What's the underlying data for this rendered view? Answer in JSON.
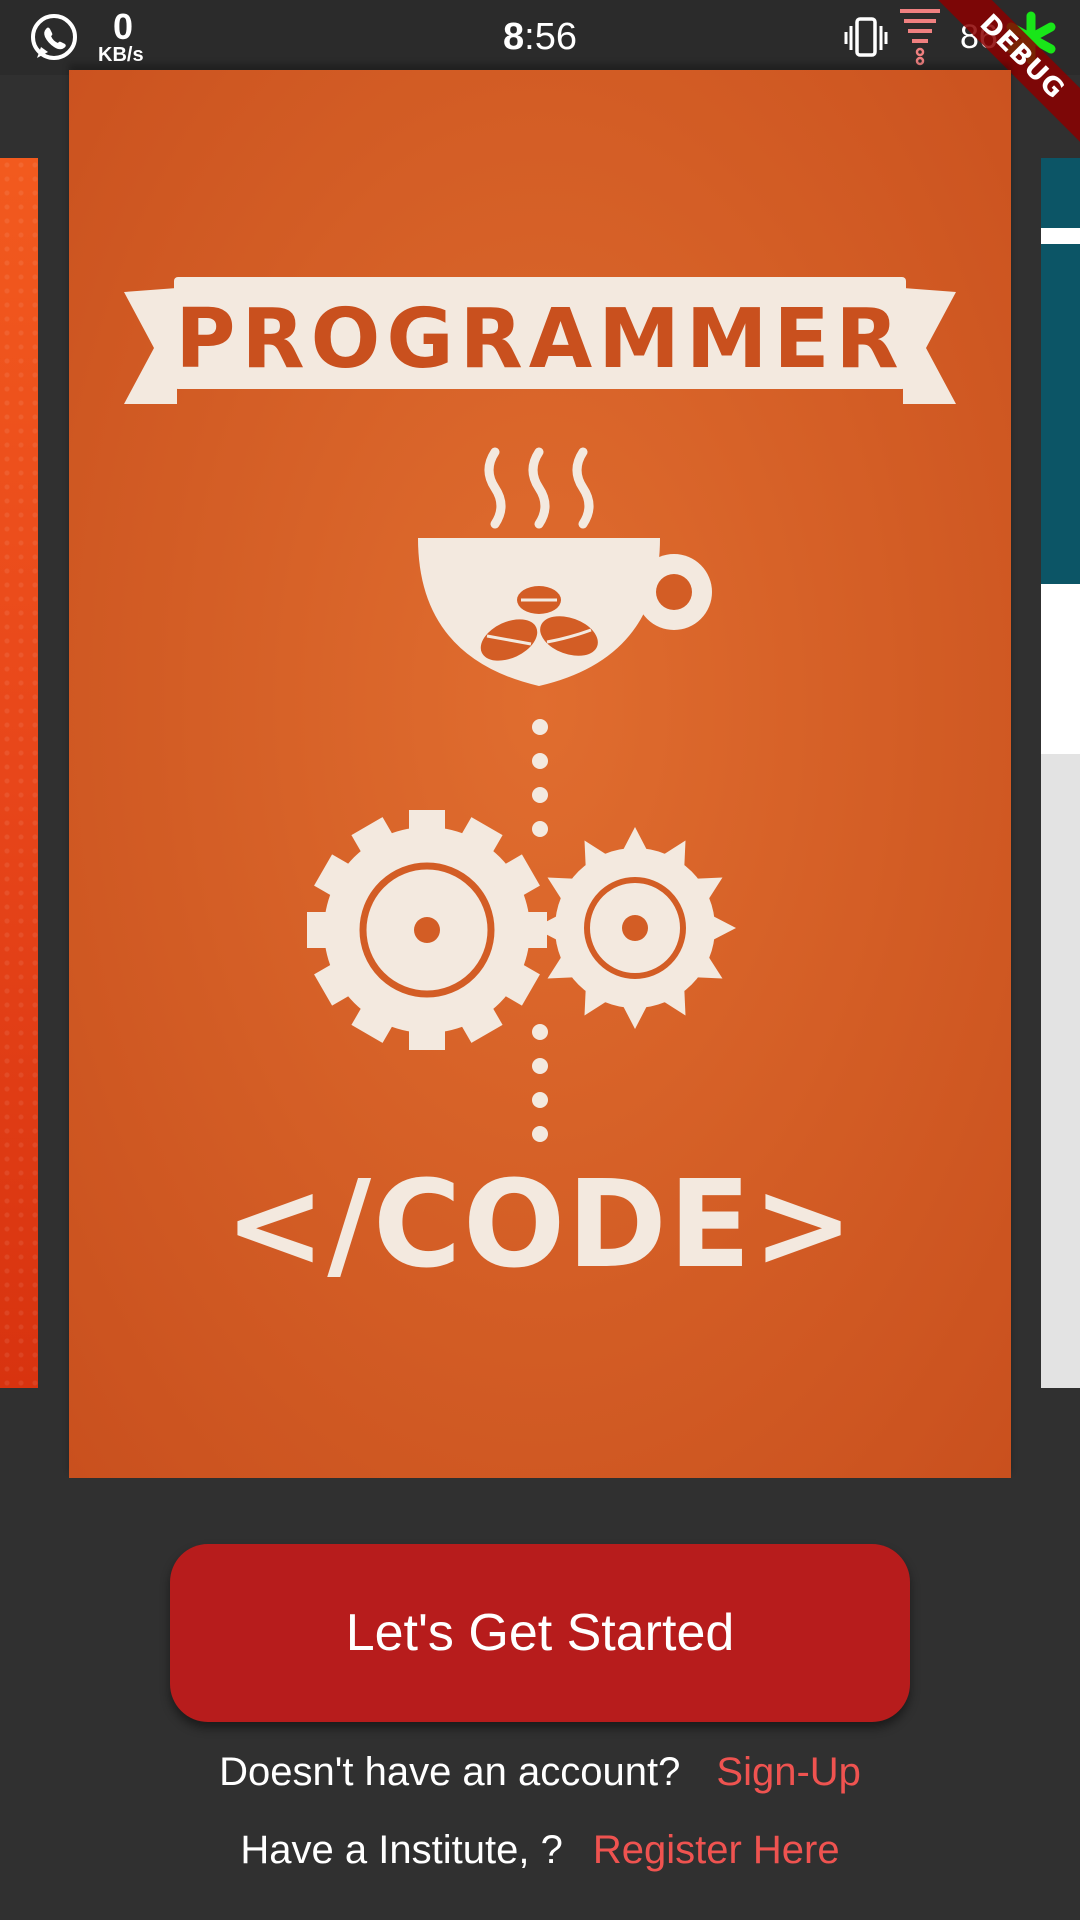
{
  "status_bar": {
    "net_speed_value": "0",
    "net_speed_unit": "KB/s",
    "time_hour": "8",
    "time_rest": ":56",
    "battery": "86",
    "icons": [
      "whatsapp-icon",
      "vibrate-icon",
      "signal-icon",
      "app-icon"
    ]
  },
  "debug_banner": "DEBUG",
  "carousel": {
    "poster_title": "PROGRAMMER",
    "poster_footer": "</CODE>",
    "colors": {
      "poster_bg": "#d35d25",
      "poster_ink": "#f3e9df"
    }
  },
  "actions": {
    "get_started": "Let's Get Started",
    "signup_question": "Doesn't have an account?",
    "signup_link": "Sign-Up",
    "institute_question": "Have a Institute, ?",
    "institute_link": "Register Here"
  },
  "colors": {
    "background": "#303030",
    "button": "#b71c1c",
    "link": "#ef5350"
  }
}
